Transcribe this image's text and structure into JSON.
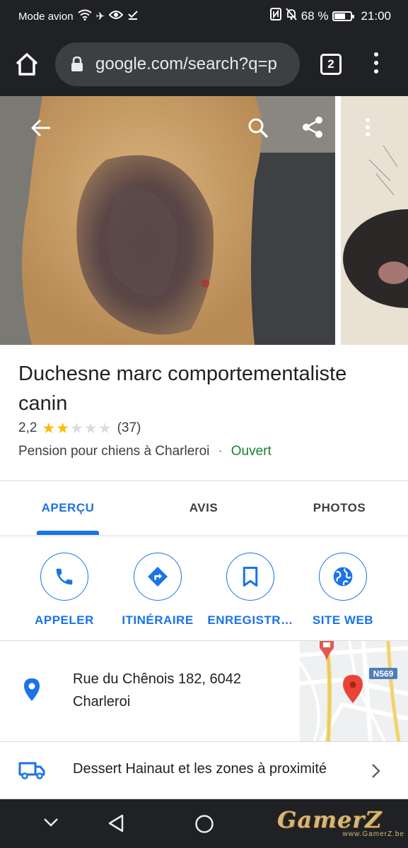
{
  "status_bar": {
    "mode_label": "Mode avion",
    "battery_text": "68 %",
    "battery_level": 0.68,
    "time": "21:00",
    "icons": [
      "wifi-icon",
      "airplane-icon",
      "eye-icon",
      "download-done-icon",
      "nfc-icon",
      "bell-off-icon",
      "battery-icon"
    ]
  },
  "browser": {
    "url": "google.com/search?q=p",
    "tab_count": "2",
    "icons": [
      "home-icon",
      "lock-icon",
      "more-vert-icon"
    ]
  },
  "photo_overlay": {
    "icons": [
      "back-arrow-icon",
      "search-icon",
      "share-icon",
      "more-vert-icon"
    ]
  },
  "place": {
    "title": "Duchesne marc comportementaliste canin",
    "rating_value": "2,2",
    "rating_stars": 2,
    "rating_max": 5,
    "review_count": "(37)",
    "category": "Pension pour chiens à Charleroi",
    "separator": "·",
    "status": "Ouvert",
    "colors": {
      "open": "#188038",
      "star_filled": "#fbbc04",
      "star_empty": "#dadce0"
    }
  },
  "tabs": [
    {
      "label": "APERÇU",
      "active": true
    },
    {
      "label": "AVIS",
      "active": false
    },
    {
      "label": "PHOTOS",
      "active": false
    }
  ],
  "actions": [
    {
      "label": "APPELER",
      "icon": "phone-icon"
    },
    {
      "label": "ITINÉRAIRE",
      "icon": "directions-icon"
    },
    {
      "label": "ENREGISTR…",
      "icon": "bookmark-icon"
    },
    {
      "label": "SITE WEB",
      "icon": "globe-icon"
    }
  ],
  "address": {
    "line1": "Rue du Chênois 182, 6042",
    "line2": "Charleroi",
    "map_road_label": "N569",
    "icon": "location-pin-icon"
  },
  "delivery": {
    "text": "Dessert Hainaut et les zones à proximité",
    "icon": "truck-icon"
  },
  "nav_bar": {
    "icons": [
      "nav-down-icon",
      "nav-back-icon",
      "nav-home-icon"
    ]
  },
  "watermark": {
    "text": "GamerZ",
    "subtext": "www.GamerZ.be"
  },
  "accent_color": "#1a73e8"
}
